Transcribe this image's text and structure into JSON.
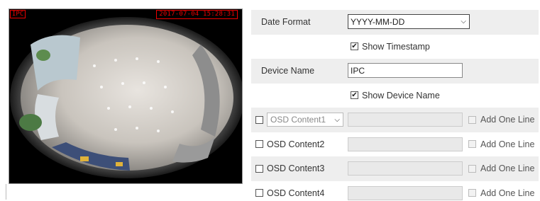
{
  "preview": {
    "osd_left_text": "IPC",
    "osd_right_text": "2017-07-04 15:28:31"
  },
  "form": {
    "date_format": {
      "label": "Date Format",
      "value": "YYYY-MM-DD"
    },
    "show_timestamp": {
      "label": "Show Timestamp",
      "checked": true
    },
    "device_name": {
      "label": "Device Name",
      "value": "IPC"
    },
    "show_device_name": {
      "label": "Show Device Name",
      "checked": true
    },
    "osd_rows": [
      {
        "label": "OSD Content1",
        "has_dropdown": true,
        "add_label": "Add One Line"
      },
      {
        "label": "OSD Content2",
        "has_dropdown": false,
        "add_label": "Add One Line"
      },
      {
        "label": "OSD Content3",
        "has_dropdown": false,
        "add_label": "Add One Line"
      },
      {
        "label": "OSD Content4",
        "has_dropdown": false,
        "add_label": "Add One Line"
      }
    ]
  },
  "icons": {
    "checkmark": "✔",
    "chevron": "⌄"
  },
  "colors": {
    "osd_red": "#e00000",
    "row_shade": "#eeeeee"
  }
}
